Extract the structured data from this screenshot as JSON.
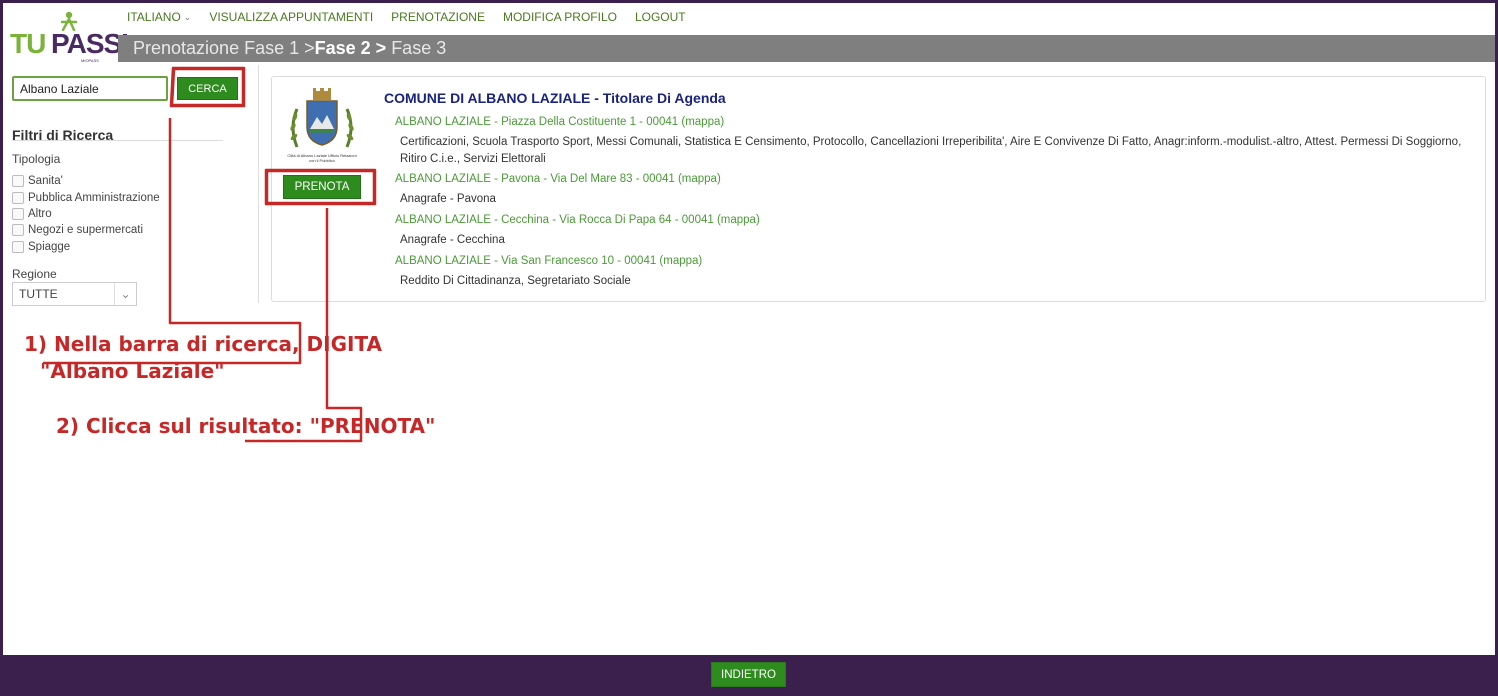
{
  "logo": {
    "brand_left": "TU",
    "brand_right": "PASSI",
    "tagline": "MIOPASS"
  },
  "nav": {
    "language": "ITALIANO",
    "appointments": "VISUALIZZA APPUNTAMENTI",
    "booking": "PRENOTAZIONE",
    "profile": "MODIFICA PROFILO",
    "logout": "LOGOUT"
  },
  "phase": {
    "phase1": "Prenotazione Fase 1 >",
    "phase2": "Fase 2 >",
    "phase3": " Fase 3"
  },
  "search": {
    "value": "Albano Laziale",
    "button": "CERCA"
  },
  "filters": {
    "title": "Filtri di Ricerca",
    "typology_label": "Tipologia",
    "typology": [
      "Sanita'",
      "Pubblica Amministrazione",
      "Altro",
      "Negozi e supermercati",
      "Spiagge"
    ],
    "region_label": "Regione",
    "region_value": "TUTTE"
  },
  "result": {
    "crest_caption": "Città di Albano Laziale Ufficio Relazioni con il Pubblico",
    "book_button": "PRENOTA",
    "agency": "COMUNE DI ALBANO LAZIALE - Titolare Di Agenda",
    "locations": [
      {
        "address": "ALBANO LAZIALE - Piazza Della Costituente 1 - 00041 (mappa)",
        "services": "Certificazioni, Scuola Trasporto Sport, Messi Comunali, Statistica E Censimento, Protocollo, Cancellazioni Irreperibilita', Aire E Convivenze Di Fatto, Anagr:inform.-modulist.-altro, Attest. Permessi Di Soggiorno, Ritiro C.i.e., Servizi Elettorali"
      },
      {
        "address": "ALBANO LAZIALE - Pavona - Via Del Mare 83 - 00041 (mappa)",
        "services": "Anagrafe - Pavona"
      },
      {
        "address": "ALBANO LAZIALE - Cecchina - Via Rocca Di Papa 64 - 00041 (mappa)",
        "services": "Anagrafe - Cecchina"
      },
      {
        "address": "ALBANO LAZIALE - Via San Francesco 10 - 00041 (mappa)",
        "services": "Reddito Di Cittadinanza, Segretariato Sociale"
      }
    ]
  },
  "annotations": {
    "step1_line1": "1) Nella barra di ricerca, DIGITA",
    "step1_line2": "\"Albano Laziale\"",
    "step2": "2) Clicca sul risultato: \"PRENOTA\"",
    "color": "#c62828"
  },
  "footer": {
    "back_button": "INDIETRO"
  },
  "colors": {
    "accent_green": "#2e8b1e",
    "link_green": "#4a9a36",
    "frame": "#3b1f4d",
    "title_blue": "#1a237e",
    "phase_bar": "#7f7f7f"
  }
}
